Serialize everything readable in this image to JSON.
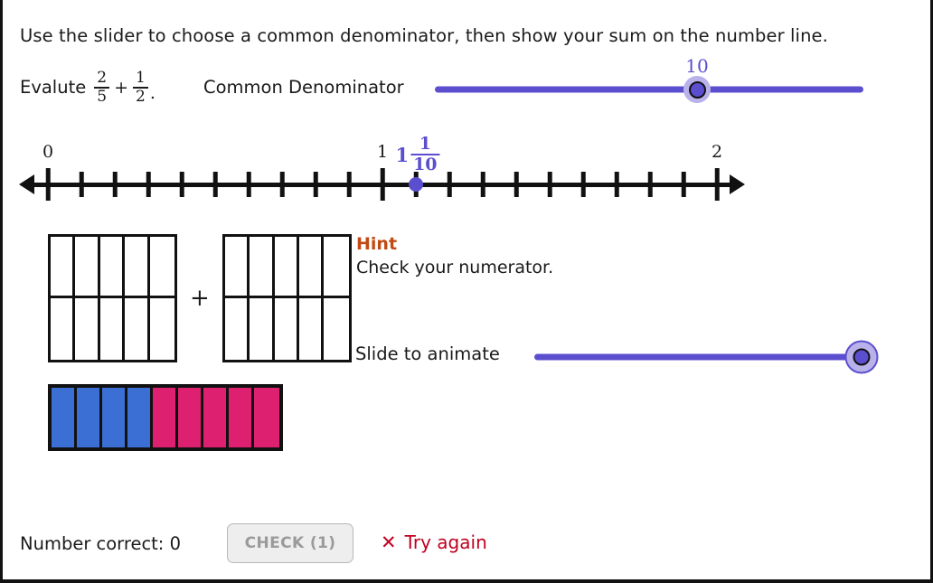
{
  "prompt": "Use the slider to choose a common denominator, then show your sum on the number line.",
  "problem": {
    "lead": "Evalute",
    "fraction_a": {
      "numerator": "2",
      "denominator": "5"
    },
    "operator": "+",
    "fraction_b": {
      "numerator": "1",
      "denominator": "2"
    },
    "terminator": "."
  },
  "common_denominator": {
    "label": "Common Denominator",
    "value": "10",
    "accent_color": "#5b4fcf"
  },
  "number_line": {
    "labels": [
      {
        "text": "0",
        "position": 0
      },
      {
        "text": "1",
        "position": 10
      },
      {
        "text": "2",
        "position": 20
      }
    ],
    "tick_count": 21,
    "marker": {
      "whole": "1",
      "numerator": "1",
      "denominator": "10",
      "position": 11,
      "color": "#5b4fcf"
    }
  },
  "fraction_grids": {
    "operator": "+",
    "boxes": [
      {
        "columns": 5,
        "rows": 2,
        "filled": 0
      },
      {
        "columns": 5,
        "rows": 2,
        "filled": 0
      }
    ]
  },
  "hint": {
    "title": "Hint",
    "body": "Check your numerator.",
    "title_color": "#c14a12"
  },
  "animate": {
    "label": "Slide to animate",
    "value": 100
  },
  "result_bar": {
    "segments": [
      {
        "color": "#3b6fd4"
      },
      {
        "color": "#3b6fd4"
      },
      {
        "color": "#3b6fd4"
      },
      {
        "color": "#3b6fd4"
      },
      {
        "color": "#dd2070"
      },
      {
        "color": "#dd2070"
      },
      {
        "color": "#dd2070"
      },
      {
        "color": "#dd2070"
      },
      {
        "color": "#dd2070"
      }
    ],
    "blue_color": "#3b6fd4",
    "pink_color": "#dd2070"
  },
  "footer": {
    "score_text": "Number correct: 0",
    "check_label": "CHECK (1)",
    "feedback_icon": "✕",
    "feedback_text": "Try again",
    "feedback_color": "#c00020"
  }
}
